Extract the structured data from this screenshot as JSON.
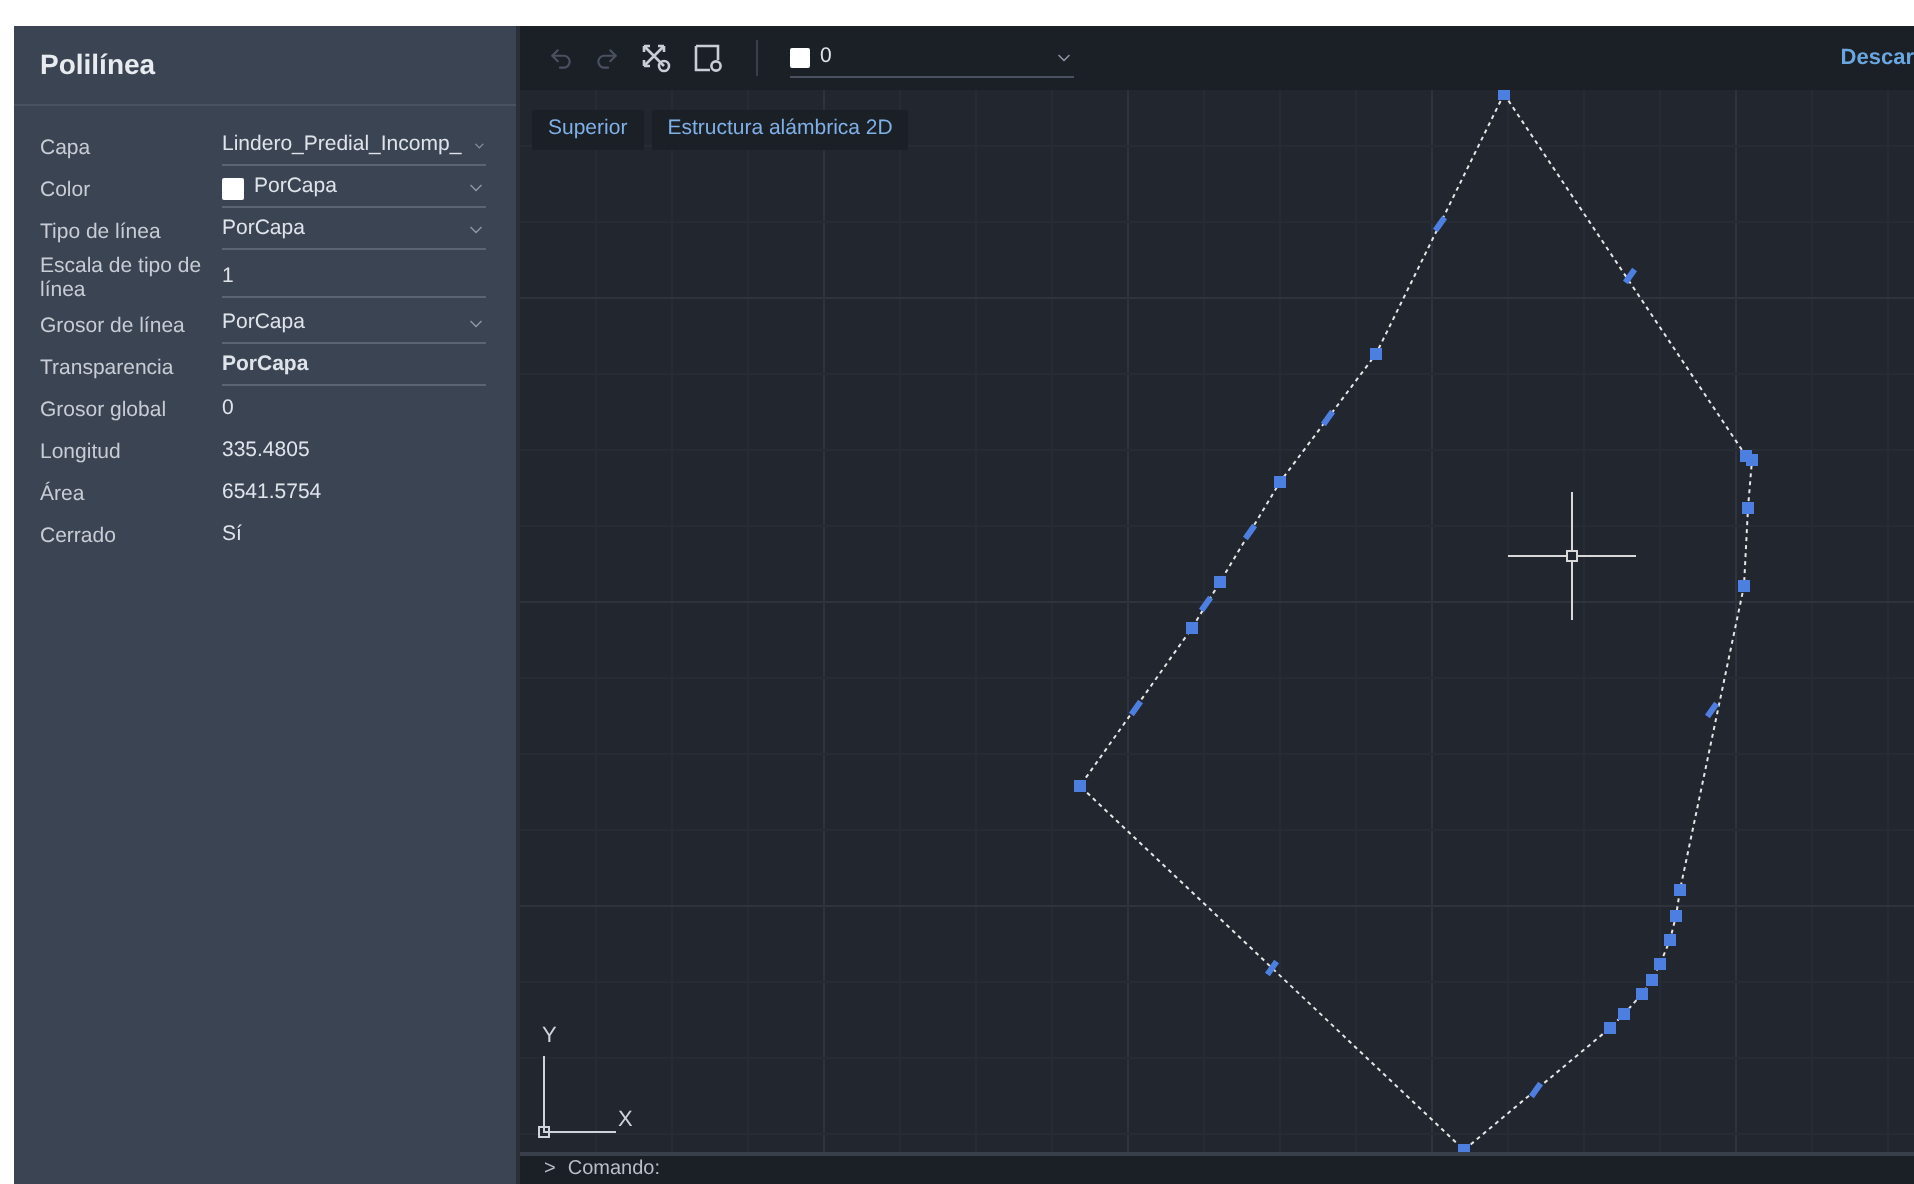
{
  "panel": {
    "title": "Polilínea",
    "properties": [
      {
        "label": "Capa",
        "value": "Lindero_Predial_Incomp_",
        "kind": "dropdown"
      },
      {
        "label": "Color",
        "value": "PorCapa",
        "kind": "dropdown",
        "color": "#ffffff"
      },
      {
        "label": "Tipo de línea",
        "value": "PorCapa",
        "kind": "dropdown"
      },
      {
        "label": "Escala de tipo de línea",
        "value": "1",
        "kind": "field"
      },
      {
        "label": "Grosor de línea",
        "value": "PorCapa",
        "kind": "dropdown"
      },
      {
        "label": "Transparencia",
        "value": "PorCapa",
        "kind": "field"
      },
      {
        "label": "Grosor global",
        "value": "0",
        "kind": "static"
      },
      {
        "label": "Longitud",
        "value": "335.4805",
        "kind": "static"
      },
      {
        "label": "Área",
        "value": "6541.5754",
        "kind": "static"
      },
      {
        "label": "Cerrado",
        "value": "Sí",
        "kind": "static"
      }
    ]
  },
  "toolbar": {
    "layer": {
      "value": "0",
      "color": "#ffffff"
    },
    "right_button": "Descar"
  },
  "view_buttons": [
    "Superior",
    "Estructura alámbrica 2D"
  ],
  "ucs": {
    "y": "Y",
    "x": "X"
  },
  "command_line": {
    "prompt": ">",
    "label": "Comando:"
  }
}
